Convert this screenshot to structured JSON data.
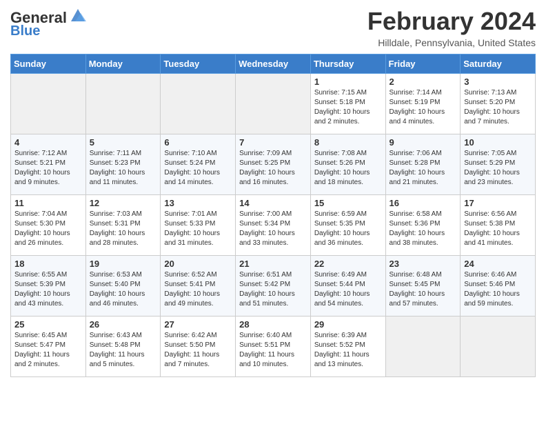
{
  "header": {
    "logo_line1": "General",
    "logo_line2": "Blue",
    "month_title": "February 2024",
    "location": "Hilldale, Pennsylvania, United States"
  },
  "days_of_week": [
    "Sunday",
    "Monday",
    "Tuesday",
    "Wednesday",
    "Thursday",
    "Friday",
    "Saturday"
  ],
  "weeks": [
    [
      {
        "day": "",
        "info": ""
      },
      {
        "day": "",
        "info": ""
      },
      {
        "day": "",
        "info": ""
      },
      {
        "day": "",
        "info": ""
      },
      {
        "day": "1",
        "info": "Sunrise: 7:15 AM\nSunset: 5:18 PM\nDaylight: 10 hours\nand 2 minutes."
      },
      {
        "day": "2",
        "info": "Sunrise: 7:14 AM\nSunset: 5:19 PM\nDaylight: 10 hours\nand 4 minutes."
      },
      {
        "day": "3",
        "info": "Sunrise: 7:13 AM\nSunset: 5:20 PM\nDaylight: 10 hours\nand 7 minutes."
      }
    ],
    [
      {
        "day": "4",
        "info": "Sunrise: 7:12 AM\nSunset: 5:21 PM\nDaylight: 10 hours\nand 9 minutes."
      },
      {
        "day": "5",
        "info": "Sunrise: 7:11 AM\nSunset: 5:23 PM\nDaylight: 10 hours\nand 11 minutes."
      },
      {
        "day": "6",
        "info": "Sunrise: 7:10 AM\nSunset: 5:24 PM\nDaylight: 10 hours\nand 14 minutes."
      },
      {
        "day": "7",
        "info": "Sunrise: 7:09 AM\nSunset: 5:25 PM\nDaylight: 10 hours\nand 16 minutes."
      },
      {
        "day": "8",
        "info": "Sunrise: 7:08 AM\nSunset: 5:26 PM\nDaylight: 10 hours\nand 18 minutes."
      },
      {
        "day": "9",
        "info": "Sunrise: 7:06 AM\nSunset: 5:28 PM\nDaylight: 10 hours\nand 21 minutes."
      },
      {
        "day": "10",
        "info": "Sunrise: 7:05 AM\nSunset: 5:29 PM\nDaylight: 10 hours\nand 23 minutes."
      }
    ],
    [
      {
        "day": "11",
        "info": "Sunrise: 7:04 AM\nSunset: 5:30 PM\nDaylight: 10 hours\nand 26 minutes."
      },
      {
        "day": "12",
        "info": "Sunrise: 7:03 AM\nSunset: 5:31 PM\nDaylight: 10 hours\nand 28 minutes."
      },
      {
        "day": "13",
        "info": "Sunrise: 7:01 AM\nSunset: 5:33 PM\nDaylight: 10 hours\nand 31 minutes."
      },
      {
        "day": "14",
        "info": "Sunrise: 7:00 AM\nSunset: 5:34 PM\nDaylight: 10 hours\nand 33 minutes."
      },
      {
        "day": "15",
        "info": "Sunrise: 6:59 AM\nSunset: 5:35 PM\nDaylight: 10 hours\nand 36 minutes."
      },
      {
        "day": "16",
        "info": "Sunrise: 6:58 AM\nSunset: 5:36 PM\nDaylight: 10 hours\nand 38 minutes."
      },
      {
        "day": "17",
        "info": "Sunrise: 6:56 AM\nSunset: 5:38 PM\nDaylight: 10 hours\nand 41 minutes."
      }
    ],
    [
      {
        "day": "18",
        "info": "Sunrise: 6:55 AM\nSunset: 5:39 PM\nDaylight: 10 hours\nand 43 minutes."
      },
      {
        "day": "19",
        "info": "Sunrise: 6:53 AM\nSunset: 5:40 PM\nDaylight: 10 hours\nand 46 minutes."
      },
      {
        "day": "20",
        "info": "Sunrise: 6:52 AM\nSunset: 5:41 PM\nDaylight: 10 hours\nand 49 minutes."
      },
      {
        "day": "21",
        "info": "Sunrise: 6:51 AM\nSunset: 5:42 PM\nDaylight: 10 hours\nand 51 minutes."
      },
      {
        "day": "22",
        "info": "Sunrise: 6:49 AM\nSunset: 5:44 PM\nDaylight: 10 hours\nand 54 minutes."
      },
      {
        "day": "23",
        "info": "Sunrise: 6:48 AM\nSunset: 5:45 PM\nDaylight: 10 hours\nand 57 minutes."
      },
      {
        "day": "24",
        "info": "Sunrise: 6:46 AM\nSunset: 5:46 PM\nDaylight: 10 hours\nand 59 minutes."
      }
    ],
    [
      {
        "day": "25",
        "info": "Sunrise: 6:45 AM\nSunset: 5:47 PM\nDaylight: 11 hours\nand 2 minutes."
      },
      {
        "day": "26",
        "info": "Sunrise: 6:43 AM\nSunset: 5:48 PM\nDaylight: 11 hours\nand 5 minutes."
      },
      {
        "day": "27",
        "info": "Sunrise: 6:42 AM\nSunset: 5:50 PM\nDaylight: 11 hours\nand 7 minutes."
      },
      {
        "day": "28",
        "info": "Sunrise: 6:40 AM\nSunset: 5:51 PM\nDaylight: 11 hours\nand 10 minutes."
      },
      {
        "day": "29",
        "info": "Sunrise: 6:39 AM\nSunset: 5:52 PM\nDaylight: 11 hours\nand 13 minutes."
      },
      {
        "day": "",
        "info": ""
      },
      {
        "day": "",
        "info": ""
      }
    ]
  ]
}
